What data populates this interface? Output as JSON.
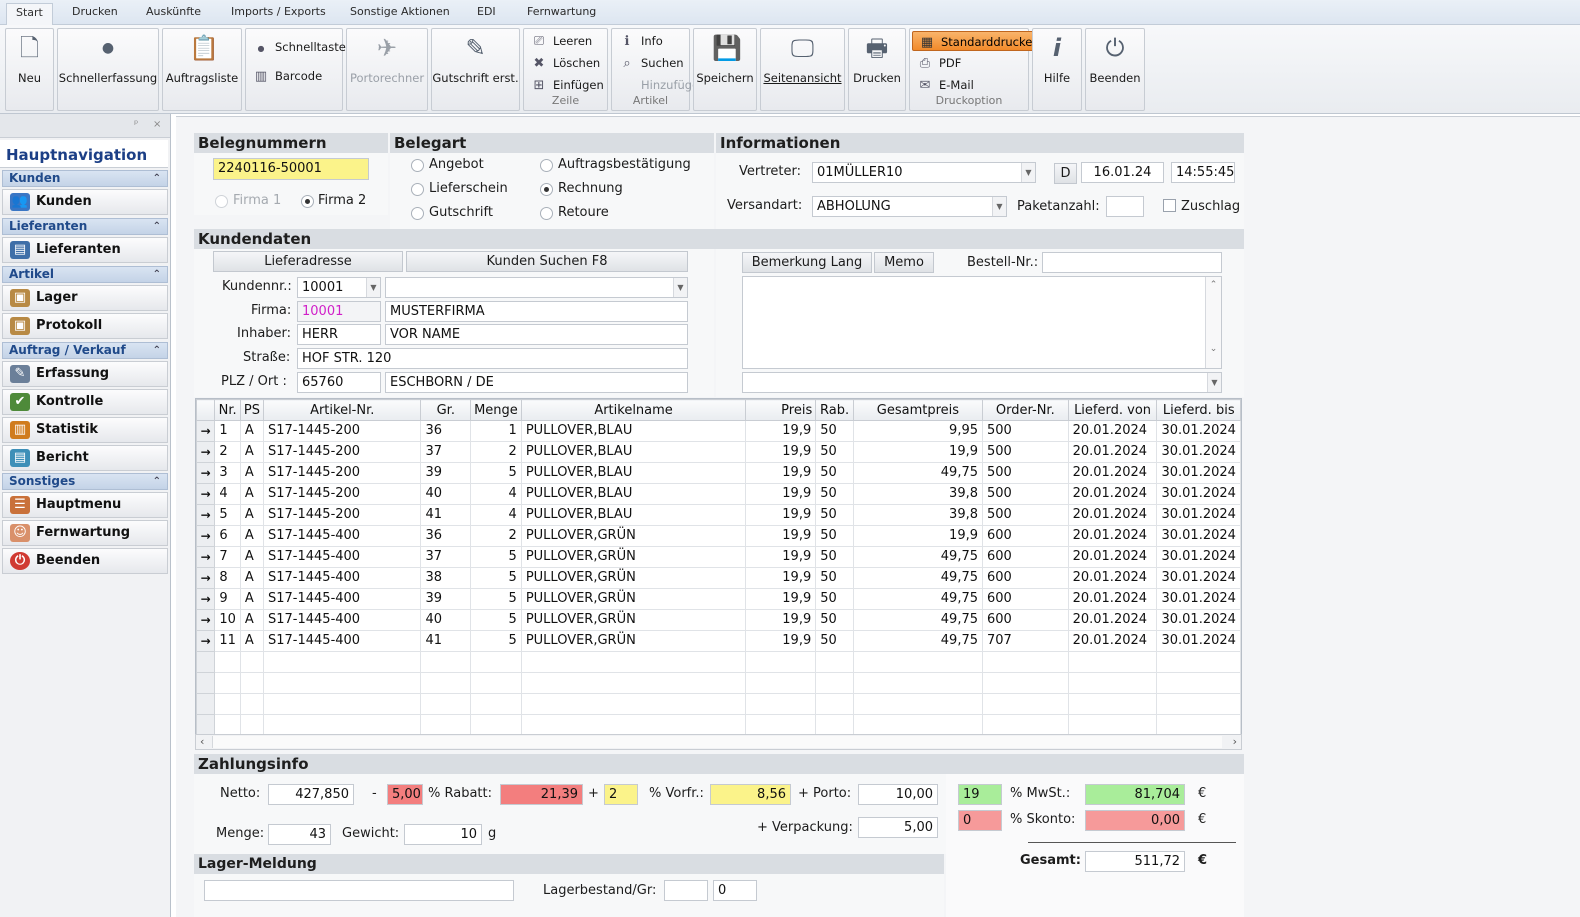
{
  "menu": {
    "tabs": [
      "Start",
      "Drucken",
      "Auskünfte",
      "Imports / Exports",
      "Sonstige Aktionen",
      "EDI",
      "Fernwartung"
    ]
  },
  "ribbon": {
    "neu": "Neu",
    "schnellerfassung": "Schnellerfassung",
    "auftragsliste": "Auftragsliste",
    "schnelltaste": "Schnelltaste",
    "barcode": "Barcode",
    "portorechner": "Portorechner",
    "gutschrift": "Gutschrift erst.",
    "zeile": {
      "leeren": "Leeren",
      "loeschen": "Löschen",
      "einfuegen": "Einfügen",
      "title": "Zeile"
    },
    "artikel": {
      "info": "Info",
      "suchen": "Suchen",
      "hinzufuegen": "Hinzufügen",
      "title": "Artikel"
    },
    "speichern": "Speichern",
    "seitenansicht": "Seitenansicht",
    "drucken": "Drucken",
    "druckoption": {
      "standarddrucker": "Standarddrucker",
      "pdf": "PDF",
      "email": "E-Mail",
      "title": "Druckoption"
    },
    "hilfe": "Hilfe",
    "beenden": "Beenden"
  },
  "sidebar": {
    "pin": "ᵖ",
    "close": "×",
    "title": "Hauptnavigation",
    "groups": [
      {
        "label": "Kunden",
        "items": [
          "Kunden"
        ]
      },
      {
        "label": "Lieferanten",
        "items": [
          "Lieferanten"
        ]
      },
      {
        "label": "Artikel",
        "items": [
          "Lager",
          "Protokoll"
        ]
      },
      {
        "label": "Auftrag / Verkauf",
        "items": [
          "Erfassung",
          "Kontrolle",
          "Statistik",
          "Bericht"
        ]
      },
      {
        "label": "Sonstiges",
        "items": [
          "Hauptmenu",
          "Fernwartung",
          "Beenden"
        ]
      }
    ]
  },
  "beleg": {
    "title": "Belegnummern",
    "nummer": "2240116-50001",
    "firma1": "Firma 1",
    "firma2": "Firma 2"
  },
  "belegart": {
    "title": "Belegart",
    "angebot": "Angebot",
    "lieferschein": "Lieferschein",
    "gutschrift": "Gutschrift",
    "auftrag": "Auftragsbestätigung",
    "rechnung": "Rechnung",
    "retoure": "Retoure"
  },
  "info": {
    "title": "Informationen",
    "vertreter_label": "Vertreter:",
    "vertreter": "01MÜLLER10",
    "d": "D",
    "datum": "16.01.24",
    "zeit": "14:55:45",
    "versand_label": "Versandart:",
    "versand": "ABHOLUNG",
    "paket_label": "Paketanzahl:",
    "paket": "",
    "zuschlag": "Zuschlag"
  },
  "kunde": {
    "title": "Kundendaten",
    "lieferadresse": "Lieferadresse",
    "suchen": "Kunden Suchen      F8",
    "kundennr_label": "Kundennr.:",
    "kundennr": "10001",
    "kundennr2": "",
    "firma_label": "Firma:",
    "firma_nr": "10001",
    "firma": "MUSTERFIRMA",
    "inhaber_label": "Inhaber:",
    "anrede": "HERR",
    "name": "VOR NAME",
    "strasse_label": "Straße:",
    "strasse": "HOF STR. 120",
    "plz_label": "PLZ / Ort :",
    "plz": "65760",
    "ort": "ESCHBORN / DE",
    "bemerkung": "Bemerkung Lang",
    "memo": "Memo",
    "bestell_label": "Bestell-Nr.:",
    "bestell": ""
  },
  "grid": {
    "headers": [
      "",
      "Nr.",
      "PS",
      "Artikel-Nr.",
      "Gr.",
      "Menge",
      "Artikelname",
      "Preis",
      "Rab.",
      "Gesamtpreis",
      "Order-Nr.",
      "Lieferd. von",
      "Lieferd. bis"
    ],
    "rows": [
      [
        "1",
        "A",
        "S17-1445-200",
        "36",
        "1",
        "PULLOVER,BLAU",
        "19,9",
        "50",
        "9,95",
        "500",
        "20.01.2024",
        "30.01.2024"
      ],
      [
        "2",
        "A",
        "S17-1445-200",
        "37",
        "2",
        "PULLOVER,BLAU",
        "19,9",
        "50",
        "19,9",
        "500",
        "20.01.2024",
        "30.01.2024"
      ],
      [
        "3",
        "A",
        "S17-1445-200",
        "39",
        "5",
        "PULLOVER,BLAU",
        "19,9",
        "50",
        "49,75",
        "500",
        "20.01.2024",
        "30.01.2024"
      ],
      [
        "4",
        "A",
        "S17-1445-200",
        "40",
        "4",
        "PULLOVER,BLAU",
        "19,9",
        "50",
        "39,8",
        "500",
        "20.01.2024",
        "30.01.2024"
      ],
      [
        "5",
        "A",
        "S17-1445-200",
        "41",
        "4",
        "PULLOVER,BLAU",
        "19,9",
        "50",
        "39,8",
        "500",
        "20.01.2024",
        "30.01.2024"
      ],
      [
        "6",
        "A",
        "S17-1445-400",
        "36",
        "2",
        "PULLOVER,GRÜN",
        "19,9",
        "50",
        "19,9",
        "600",
        "20.01.2024",
        "30.01.2024"
      ],
      [
        "7",
        "A",
        "S17-1445-400",
        "37",
        "5",
        "PULLOVER,GRÜN",
        "19,9",
        "50",
        "49,75",
        "600",
        "20.01.2024",
        "30.01.2024"
      ],
      [
        "8",
        "A",
        "S17-1445-400",
        "38",
        "5",
        "PULLOVER,GRÜN",
        "19,9",
        "50",
        "49,75",
        "600",
        "20.01.2024",
        "30.01.2024"
      ],
      [
        "9",
        "A",
        "S17-1445-400",
        "39",
        "5",
        "PULLOVER,GRÜN",
        "19,9",
        "50",
        "49,75",
        "600",
        "20.01.2024",
        "30.01.2024"
      ],
      [
        "10",
        "A",
        "S17-1445-400",
        "40",
        "5",
        "PULLOVER,GRÜN",
        "19,9",
        "50",
        "49,75",
        "600",
        "20.01.2024",
        "30.01.2024"
      ],
      [
        "11",
        "A",
        "S17-1445-400",
        "41",
        "5",
        "PULLOVER,GRÜN",
        "19,9",
        "50",
        "49,75",
        "707",
        "20.01.2024",
        "30.01.2024"
      ]
    ]
  },
  "zahlung": {
    "title": "Zahlungsinfo",
    "netto_label": "Netto:",
    "netto": "427,850",
    "minus": "-",
    "rabatt_pct": "5,00",
    "rabatt_label": "% Rabatt:",
    "rabatt": "21,39",
    "plus": "+",
    "vorfr_pct": "2",
    "vorfr_label": "% Vorfr.:",
    "vorfr": "8,56",
    "porto_label": "+ Porto:",
    "porto": "10,00",
    "menge_label": "Menge:",
    "menge": "43",
    "gewicht_label": "Gewicht:",
    "gewicht": "10",
    "g": "g",
    "verpackung_label": "+ Verpackung:",
    "verpackung": "5,00",
    "mwst_pct": "19",
    "mwst_label": "%   MwSt.:",
    "mwst": "81,704",
    "skonto_pct": "0",
    "skonto_label": "% Skonto:",
    "skonto": "0,00",
    "eur": "€",
    "gesamt_label": "Gesamt:",
    "gesamt": "511,72"
  },
  "lager": {
    "title": "Lager-Meldung",
    "meldung": "",
    "bestand_label": "Lagerbestand/Gr:",
    "bestand1": "",
    "bestand2": "0"
  }
}
